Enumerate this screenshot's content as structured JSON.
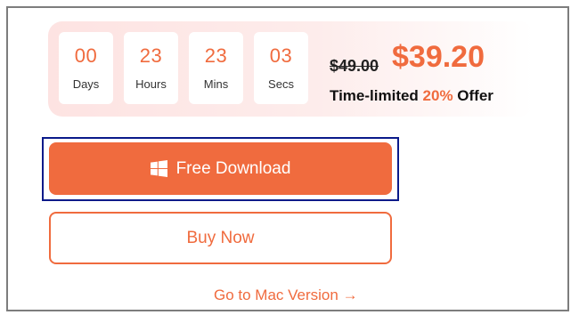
{
  "countdown": [
    {
      "value": "00",
      "unit": "Days"
    },
    {
      "value": "23",
      "unit": "Hours"
    },
    {
      "value": "23",
      "unit": "Mins"
    },
    {
      "value": "03",
      "unit": "Secs"
    }
  ],
  "pricing": {
    "old_price": "$49.00",
    "new_price": "$39.20",
    "offer_prefix": "Time-limited ",
    "offer_percent": "20%",
    "offer_suffix": " Offer"
  },
  "buttons": {
    "download_label": "Free Download",
    "download_icon": "windows-icon",
    "buy_label": "Buy Now"
  },
  "links": {
    "mac_version": "Go to Mac Version →"
  },
  "colors": {
    "accent": "#f06b3e",
    "promo_background": "#fde3e2",
    "focus_ring": "#0a1a8a"
  }
}
